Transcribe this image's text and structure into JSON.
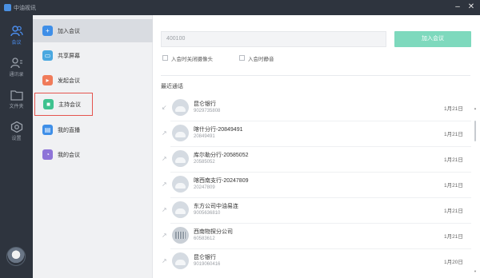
{
  "window": {
    "title": "中油视讯"
  },
  "rail": {
    "items": [
      {
        "label": "会议",
        "icon": "meeting-users-icon"
      },
      {
        "label": "通讯录",
        "icon": "contacts-icon"
      },
      {
        "label": "文件夹",
        "icon": "folder-icon"
      },
      {
        "label": "设置",
        "icon": "gear-icon"
      }
    ]
  },
  "submenu": {
    "items": [
      {
        "label": "加入会议",
        "icon": "join-icon",
        "color": "#3f8fe8"
      },
      {
        "label": "共享屏幕",
        "icon": "screen-share-icon",
        "color": "#4aa8e0"
      },
      {
        "label": "发起会议",
        "icon": "video-icon",
        "color": "#f07b5a"
      },
      {
        "label": "主持会议",
        "icon": "host-icon",
        "color": "#3ec28f"
      },
      {
        "label": "我的直播",
        "icon": "live-icon",
        "color": "#3f8fe8"
      },
      {
        "label": "我的会议",
        "icon": "clock-icon",
        "color": "#8e74d8"
      }
    ]
  },
  "join": {
    "meeting_id": "400100",
    "button_label": "加入会议",
    "option_camera": "入会时关闭摄像头",
    "option_mic": "入会时静音"
  },
  "recent": {
    "title": "最近通话",
    "calls": [
      {
        "name": "昆仑银行",
        "number": "9029735808",
        "date": "1月21日",
        "direction": "incoming",
        "avatar": "person"
      },
      {
        "name": "喀什分行-20849491",
        "number": "20849491",
        "date": "1月21日",
        "direction": "outgoing",
        "avatar": "person"
      },
      {
        "name": "库尔勒分行-20585052",
        "number": "20585052",
        "date": "1月21日",
        "direction": "outgoing",
        "avatar": "person"
      },
      {
        "name": "喀西南支行-20247809",
        "number": "20247809",
        "date": "1月21日",
        "direction": "outgoing",
        "avatar": "person"
      },
      {
        "name": "东方公司中油易连",
        "number": "9005636810",
        "date": "1月21日",
        "direction": "outgoing",
        "avatar": "person"
      },
      {
        "name": "西南物探分公司",
        "number": "60583612",
        "date": "1月21日",
        "direction": "outgoing",
        "avatar": "building"
      },
      {
        "name": "昆仑银行",
        "number": "9019060416",
        "date": "1月20日",
        "direction": "outgoing",
        "avatar": "person"
      }
    ]
  },
  "colors": {
    "rail_bg": "#2e343e",
    "accent": "#4c8ff0",
    "join_button": "#7ed9bd",
    "highlight_border": "#e5544e"
  }
}
